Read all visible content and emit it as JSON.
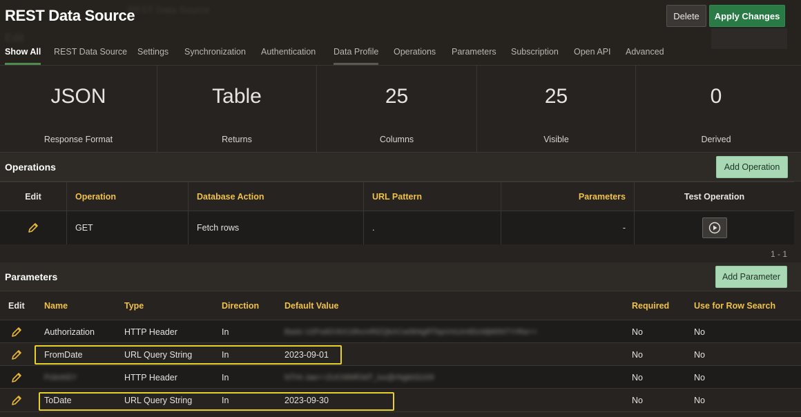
{
  "page": {
    "title": "REST Data Source",
    "ghost_text_1": "REST Data Source",
    "ghost_text_2": "Edit"
  },
  "toolbar": {
    "delete_label": "Delete",
    "apply_label": "Apply Changes"
  },
  "tabs": [
    {
      "label": "Show All"
    },
    {
      "label": "REST Data Source"
    },
    {
      "label": "Settings"
    },
    {
      "label": "Synchronization"
    },
    {
      "label": "Authentication"
    },
    {
      "label": "Data Profile"
    },
    {
      "label": "Operations"
    },
    {
      "label": "Parameters"
    },
    {
      "label": "Subscription"
    },
    {
      "label": "Open API"
    },
    {
      "label": "Advanced"
    }
  ],
  "stats": [
    {
      "value": "JSON",
      "label": "Response Format"
    },
    {
      "value": "Table",
      "label": "Returns"
    },
    {
      "value": "25",
      "label": "Columns"
    },
    {
      "value": "25",
      "label": "Visible"
    },
    {
      "value": "0",
      "label": "Derived"
    }
  ],
  "operations": {
    "title": "Operations",
    "add_label": "Add Operation",
    "headers": {
      "edit": "Edit",
      "operation": "Operation",
      "database_action": "Database Action",
      "url_pattern": "URL Pattern",
      "parameters": "Parameters",
      "test_operation": "Test Operation"
    },
    "rows": [
      {
        "operation": "GET",
        "database_action": "Fetch rows",
        "url_pattern": ".",
        "parameters": "-"
      }
    ],
    "pagination": "1 - 1"
  },
  "parameters": {
    "title": "Parameters",
    "add_label": "Add Parameter",
    "headers": {
      "edit": "Edit",
      "name": "Name",
      "type": "Type",
      "direction": "Direction",
      "default_value": "Default Value",
      "required": "Required",
      "row_search": "Use for Row Search"
    },
    "rows": [
      {
        "name": "Authorization",
        "type": "HTTP Header",
        "direction": "In",
        "default_value": "Basic U2FsdGVkX19hcmRlZQbXCw0kNgRTbpVmUm9DcMjM0NTYrRw==",
        "required": "No",
        "row_search": "No"
      },
      {
        "name": "FromDate",
        "type": "URL Query String",
        "direction": "In",
        "default_value": "2023-09-01",
        "required": "No",
        "row_search": "No"
      },
      {
        "name": "PcbnKEY",
        "type": "HTTP Header",
        "direction": "In",
        "default_value": "NTHr-Jae==ZUCMMR3dT_lux@rNgbt32z09",
        "required": "No",
        "row_search": "No"
      },
      {
        "name": "ToDate",
        "type": "URL Query String",
        "direction": "In",
        "default_value": "2023-09-30",
        "required": "No",
        "row_search": "No"
      }
    ]
  },
  "colors": {
    "accent_green": "#2a7a45",
    "header_gold": "#f0c14b",
    "highlight_yellow": "#e7d22a"
  }
}
